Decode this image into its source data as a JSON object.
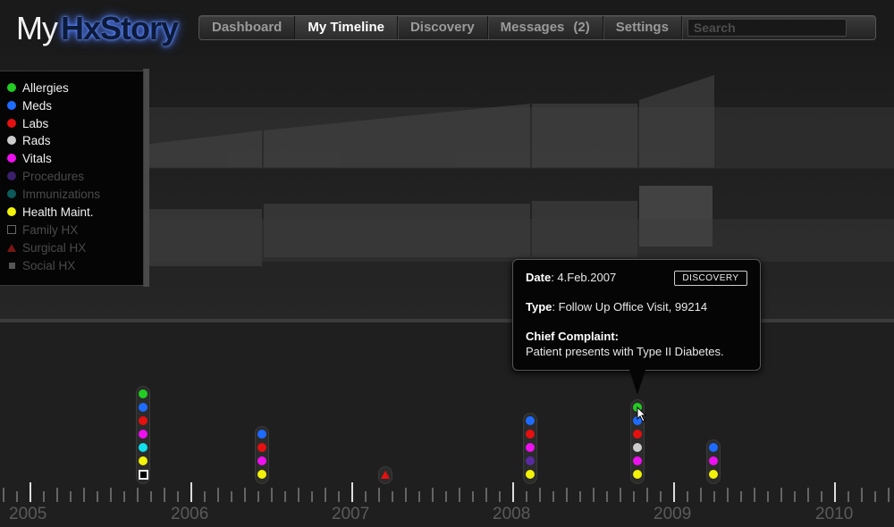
{
  "app": {
    "logo_prefix": "My",
    "logo_brand": "HxStory"
  },
  "nav": {
    "tabs": [
      {
        "label": "Dashboard",
        "active": false
      },
      {
        "label": "My Timeline",
        "active": true
      },
      {
        "label": "Discovery",
        "active": false
      },
      {
        "label": "Messages",
        "count": "(2)",
        "active": false
      },
      {
        "label": "Settings",
        "active": false
      }
    ],
    "search_placeholder": "Search"
  },
  "legend": [
    {
      "label": "Allergies",
      "color": "#22cc22",
      "enabled": true,
      "icon": "dot"
    },
    {
      "label": "Meds",
      "color": "#1e6bff",
      "enabled": true,
      "icon": "dot"
    },
    {
      "label": "Labs",
      "color": "#e51010",
      "enabled": true,
      "icon": "dot"
    },
    {
      "label": "Rads",
      "color": "#cccccc",
      "enabled": true,
      "icon": "dot"
    },
    {
      "label": "Vitals",
      "color": "#ee10ee",
      "enabled": true,
      "icon": "dot"
    },
    {
      "label": "Procedures",
      "color": "#3a1f6b",
      "enabled": false,
      "icon": "dot"
    },
    {
      "label": "Immunizations",
      "color": "#0d5a5a",
      "enabled": false,
      "icon": "dot"
    },
    {
      "label": "Health Maint.",
      "color": "#f2f20a",
      "enabled": true,
      "icon": "dot"
    },
    {
      "label": "Family HX",
      "color": "#666666",
      "enabled": false,
      "icon": "square-outline"
    },
    {
      "label": "Surgical HX",
      "color": "#7a1515",
      "enabled": false,
      "icon": "triangle"
    },
    {
      "label": "Social HX",
      "color": "#555555",
      "enabled": false,
      "icon": "square"
    }
  ],
  "tooltip": {
    "date_label": "Date",
    "date_value": "4.Feb.2007",
    "badge": "DISCOVERY",
    "type_label": "Type",
    "type_value": "Follow Up Office Visit, 99214",
    "complaint_label": "Chief Complaint:",
    "complaint_value": "Patient presents with Type II Diabetes."
  },
  "timeline": {
    "years": [
      "2005",
      "2006",
      "2007",
      "2008",
      "2009",
      "2010"
    ],
    "events": [
      {
        "name": "event-2005-q4",
        "items": [
          "allergies",
          "meds",
          "labs",
          "vitals",
          "cyan",
          "health",
          "family"
        ]
      },
      {
        "name": "event-2006-q2",
        "items": [
          "meds",
          "labs",
          "vitals",
          "health"
        ]
      },
      {
        "name": "event-2007-q1",
        "items": [
          "surgical"
        ]
      },
      {
        "name": "event-2008-q1",
        "items": [
          "meds",
          "labs",
          "vitals",
          "procedures",
          "health"
        ]
      },
      {
        "name": "event-2008-q4",
        "items": [
          "allergies",
          "meds",
          "labs",
          "rads",
          "vitals",
          "health"
        ]
      },
      {
        "name": "event-2009-q2",
        "items": [
          "meds",
          "vitals",
          "health"
        ]
      }
    ]
  }
}
